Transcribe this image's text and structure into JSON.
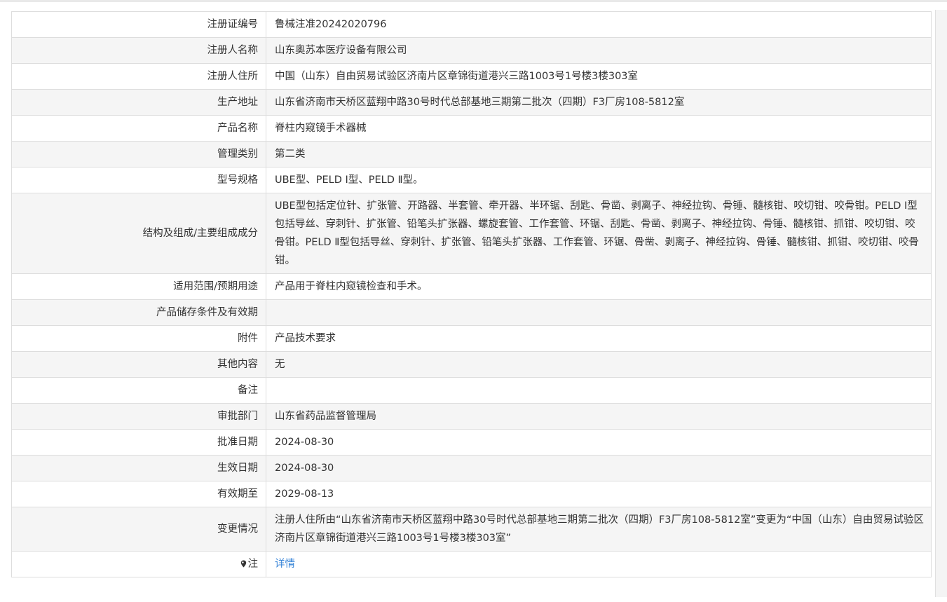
{
  "rows": [
    {
      "label": "注册证编号",
      "value": "鲁械注准20242020796"
    },
    {
      "label": "注册人名称",
      "value": "山东奥苏本医疗设备有限公司"
    },
    {
      "label": "注册人住所",
      "value": "中国（山东）自由贸易试验区济南片区章锦街道港兴三路1003号1号楼3楼303室"
    },
    {
      "label": "生产地址",
      "value": "山东省济南市天桥区蓝翔中路30号时代总部基地三期第二批次（四期）F3厂房108-5812室"
    },
    {
      "label": "产品名称",
      "value": "脊柱内窥镜手术器械"
    },
    {
      "label": "管理类别",
      "value": "第二类"
    },
    {
      "label": "型号规格",
      "value": "UBE型、PELD Ⅰ型、PELD Ⅱ型。"
    },
    {
      "label": "结构及组成/主要组成成分",
      "value": "UBE型包括定位针、扩张管、开路器、半套管、牵开器、半环锯、刮匙、骨凿、剥离子、神经拉钩、骨锤、髓核钳、咬切钳、咬骨钳。PELD Ⅰ型包括导丝、穿刺针、扩张管、铅笔头扩张器、螺旋套管、工作套管、环锯、刮匙、骨凿、剥离子、神经拉钩、骨锤、髓核钳、抓钳、咬切钳、咬骨钳。PELD Ⅱ型包括导丝、穿刺针、扩张管、铅笔头扩张器、工作套管、环锯、骨凿、剥离子、神经拉钩、骨锤、髓核钳、抓钳、咬切钳、咬骨钳。"
    },
    {
      "label": "适用范围/预期用途",
      "value": "产品用于脊柱内窥镜检查和手术。"
    },
    {
      "label": "产品储存条件及有效期",
      "value": ""
    },
    {
      "label": "附件",
      "value": "产品技术要求"
    },
    {
      "label": "其他内容",
      "value": "无"
    },
    {
      "label": "备注",
      "value": ""
    },
    {
      "label": "审批部门",
      "value": "山东省药品监督管理局"
    },
    {
      "label": "批准日期",
      "value": "2024-08-30"
    },
    {
      "label": "生效日期",
      "value": "2024-08-30"
    },
    {
      "label": "有效期至",
      "value": "2029-08-13"
    },
    {
      "label": "变更情况",
      "value": "注册人住所由“山东省济南市天桥区蓝翔中路30号时代总部基地三期第二批次（四期）F3厂房108-5812室”变更为“中国（山东）自由贸易试验区济南片区章锦街道港兴三路1003号1号楼3楼303室”"
    }
  ],
  "note": {
    "icon": "location-pin-icon",
    "label": "注",
    "link_text": "详情"
  }
}
